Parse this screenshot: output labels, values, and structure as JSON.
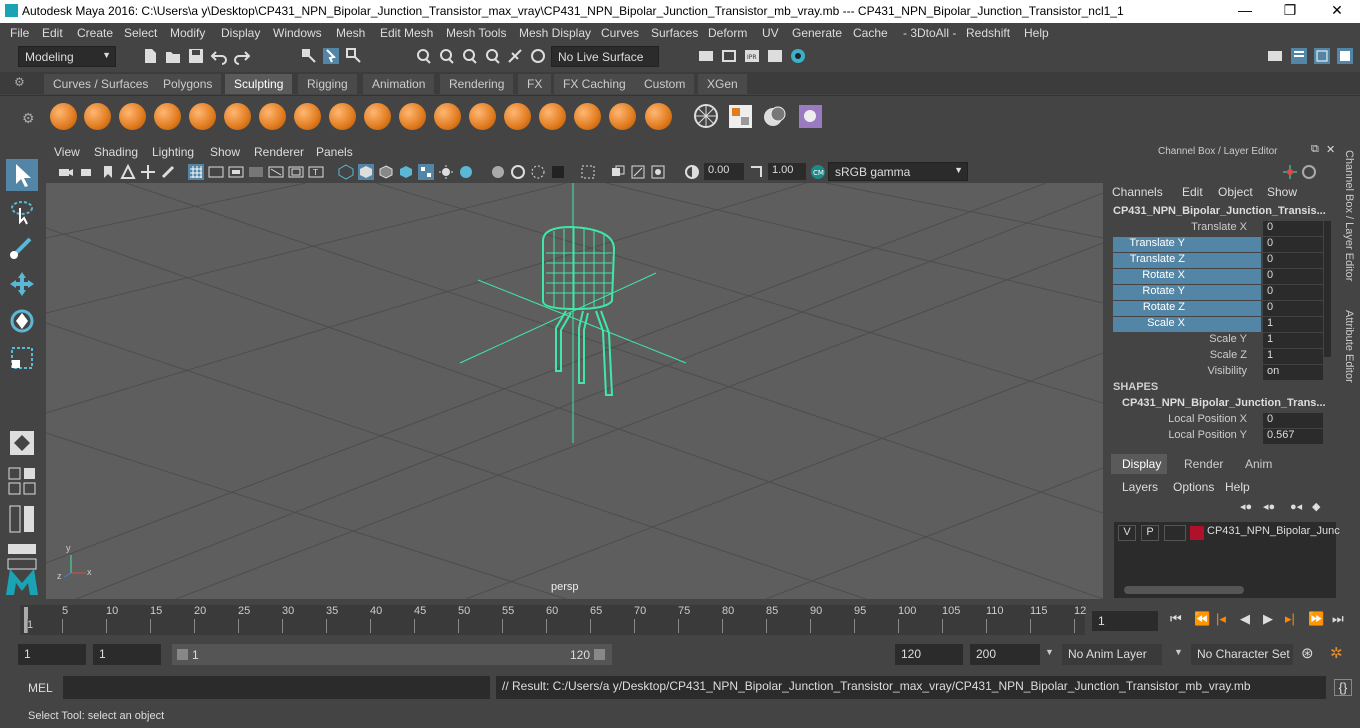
{
  "title_bar": {
    "title": "Autodesk Maya 2016: C:\\Users\\a y\\Desktop\\CP431_NPN_Bipolar_Junction_Transistor_max_vray\\CP431_NPN_Bipolar_Junction_Transistor_mb_vray.mb   ---   CP431_NPN_Bipolar_Junction_Transistor_ncl1_1",
    "minimize": "—",
    "maximize": "❐",
    "close": "✕"
  },
  "menu": [
    "File",
    "Edit",
    "Create",
    "Select",
    "Modify",
    "Display",
    "Windows",
    "Mesh",
    "Edit Mesh",
    "Mesh Tools",
    "Mesh Display",
    "Curves",
    "Surfaces",
    "Deform",
    "UV",
    "Generate",
    "Cache",
    "- 3DtoAll -",
    "Redshift",
    "Help"
  ],
  "status_line": {
    "mode": "Modeling",
    "live_surface": "No Live Surface"
  },
  "shelf_tabs": [
    "Curves / Surfaces",
    "Polygons",
    "Sculpting",
    "Rigging",
    "Animation",
    "Rendering",
    "FX",
    "FX Caching",
    "Custom",
    "XGen"
  ],
  "active_shelf_tab": "Sculpting",
  "panel_menu": [
    "View",
    "Shading",
    "Lighting",
    "Show",
    "Renderer",
    "Panels"
  ],
  "panel_bar": {
    "exposure": "0.00",
    "gamma": "1.00",
    "color_space": "sRGB gamma"
  },
  "viewport": {
    "camera_label": "persp",
    "axis": {
      "x": "x",
      "y": "y",
      "z": "z"
    },
    "wire_color": "#3fe8a8",
    "grid_color": "#4a4a4a",
    "background": "#5e5e5e"
  },
  "channel_box": {
    "header": "Channel Box / Layer Editor",
    "menus": [
      "Channels",
      "Edit",
      "Object",
      "Show"
    ],
    "object_name": "CP431_NPN_Bipolar_Junction_Transis...",
    "attributes": [
      {
        "label": "Translate X",
        "value": "0",
        "selected": false
      },
      {
        "label": "Translate Y",
        "value": "0",
        "selected": true
      },
      {
        "label": "Translate Z",
        "value": "0",
        "selected": true
      },
      {
        "label": "Rotate X",
        "value": "0",
        "selected": true
      },
      {
        "label": "Rotate Y",
        "value": "0",
        "selected": true
      },
      {
        "label": "Rotate Z",
        "value": "0",
        "selected": true
      },
      {
        "label": "Scale X",
        "value": "1",
        "selected": true
      },
      {
        "label": "Scale Y",
        "value": "1",
        "selected": false
      },
      {
        "label": "Scale Z",
        "value": "1",
        "selected": false
      },
      {
        "label": "Visibility",
        "value": "on",
        "selected": false
      }
    ],
    "shapes_header": "SHAPES",
    "shape_name": "CP431_NPN_Bipolar_Junction_Trans...",
    "shape_attributes": [
      {
        "label": "Local Position X",
        "value": "0"
      },
      {
        "label": "Local Position Y",
        "value": "0.567"
      }
    ]
  },
  "side_tabs": [
    "Channel Box / Layer Editor",
    "Attribute Editor"
  ],
  "layer_editor": {
    "tabs": [
      "Display",
      "Render",
      "Anim"
    ],
    "active_tab": "Display",
    "menus": [
      "Layers",
      "Options",
      "Help"
    ],
    "layer": {
      "v": "V",
      "p": "P",
      "name": "CP431_NPN_Bipolar_Junc",
      "color": "#b0102a"
    }
  },
  "timeline": {
    "ticks": [
      "1",
      "5",
      "10",
      "15",
      "20",
      "25",
      "30",
      "35",
      "40",
      "45",
      "50",
      "55",
      "60",
      "65",
      "70",
      "75",
      "80",
      "85",
      "90",
      "95",
      "100",
      "105",
      "110",
      "115",
      "12"
    ],
    "current_frame": "1"
  },
  "range": {
    "start": "1",
    "playback_start": "1",
    "slider_start": "1",
    "slider_end": "120",
    "playback_end": "120",
    "end": "200",
    "anim_layer": "No Anim Layer",
    "character_set": "No Character Set"
  },
  "command_line": {
    "label": "MEL",
    "result": "// Result: C:/Users/a y/Desktop/CP431_NPN_Bipolar_Junction_Transistor_max_vray/CP431_NPN_Bipolar_Junction_Transistor_mb_vray.mb"
  },
  "help_line": "Select Tool: select an object"
}
